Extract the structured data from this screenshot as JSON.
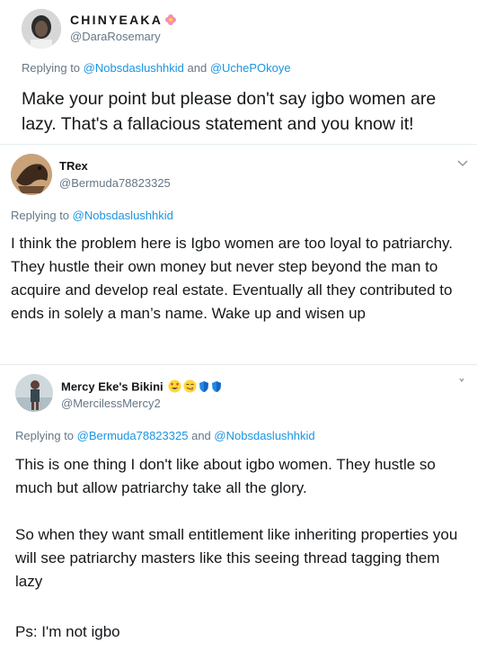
{
  "tweets": [
    {
      "name": "CHINYEAKA",
      "handle": "@DaraRosemary",
      "replying_prefix": "Replying to",
      "replying_mentions": [
        "@Nobsdaslushhkid",
        "@UchePOkoye"
      ],
      "replying_joiner": "and",
      "body": "Make your point but please don't say igbo women are lazy. That's a fallacious statement and you know it!",
      "emoji": [
        "flower-emoji"
      ]
    },
    {
      "name": "TRex",
      "handle": "@Bermuda78823325",
      "replying_prefix": "Replying to",
      "replying_mentions": [
        "@Nobsdaslushhkid"
      ],
      "replying_joiner": "",
      "body": "I think the problem here is Igbo women are too loyal to patriarchy. They hustle their own money but never step beyond the man to acquire and develop real estate. Eventually all they contributed to ends in solely a man’s name. Wake up and wisen up",
      "emoji": []
    },
    {
      "name": "Mercy Eke's Bikini",
      "handle": "@MercilessMercy2",
      "replying_prefix": "Replying to",
      "replying_mentions": [
        "@Bermuda78823325",
        "@Nobsdaslushhkid"
      ],
      "replying_joiner": "and",
      "body_paragraphs": [
        "This is one thing I don't like about igbo women. They hustle so much but allow patriarchy take all the glory.",
        "So when they want small entitlement like inheriting properties you will see patriarchy masters like this seeing thread tagging them lazy",
        "Ps: I'm not igbo"
      ],
      "emoji": [
        "heart-eyes-emoji",
        "yum-emoji",
        "blue-shield-emoji",
        "blue-shield-emoji"
      ]
    }
  ],
  "icons": {
    "chevron": "chevron-down-icon"
  },
  "colors": {
    "link": "#1b95e0",
    "secondary_text": "#657786",
    "divider": "#e6ecf0"
  }
}
